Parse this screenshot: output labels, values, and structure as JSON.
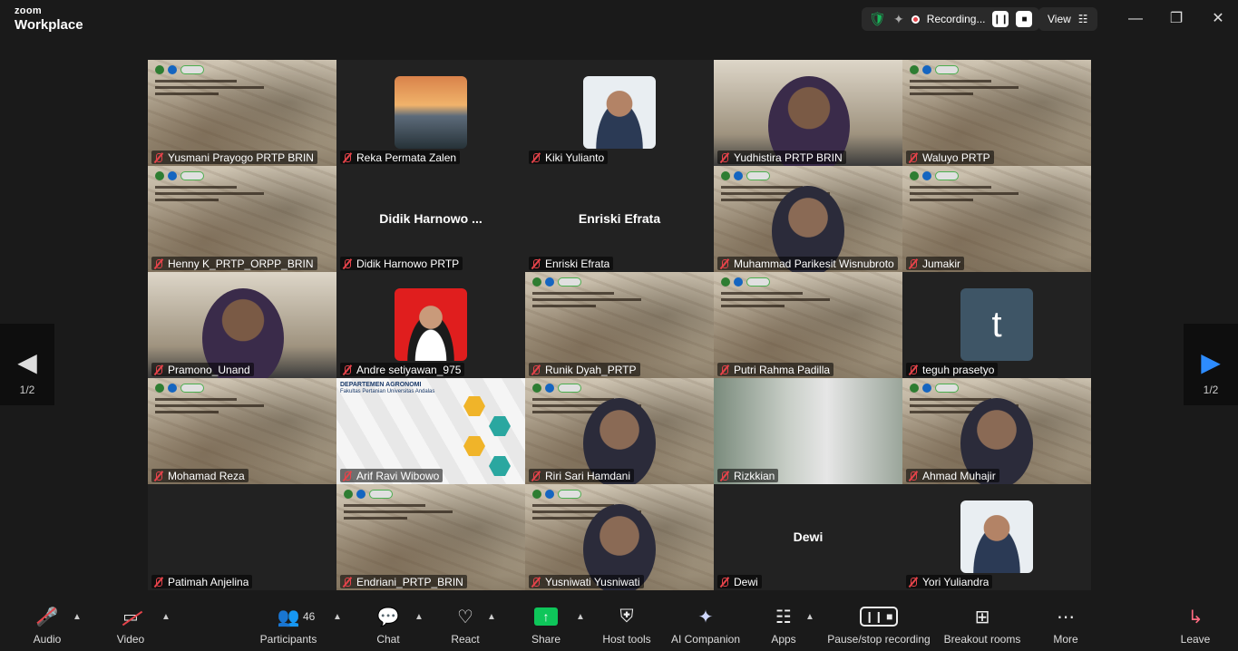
{
  "app": {
    "brand_small": "zoom",
    "brand_big": "Workplace"
  },
  "titlebar": {
    "recording_label": "Recording...",
    "view_label": "View"
  },
  "pager": {
    "left_page": "1/2",
    "right_page": "1/2"
  },
  "participants": [
    {
      "name": "Yusmani Prayogo PRTP BRIN",
      "bg": "map"
    },
    {
      "name": "Reka Permata Zalen",
      "bg": "photo-landscape"
    },
    {
      "name": "Kiki Yulianto",
      "bg": "photo-portrait"
    },
    {
      "name": "Yudhistira PRTP BRIN",
      "bg": "video"
    },
    {
      "name": "Waluyo PRTP",
      "bg": "map"
    },
    {
      "name": "Henny K_PRTP_ORPP_BRIN",
      "bg": "map"
    },
    {
      "name": "Didik Harnowo PRTP",
      "big": "Didik  Harnowo ...",
      "bg": "dark"
    },
    {
      "name": "Enriski Efrata",
      "big": "Enriski Efrata",
      "bg": "dark"
    },
    {
      "name": "Muhammad Parikesit Wisnubroto",
      "bg": "map-video",
      "active": true
    },
    {
      "name": "Jumakir",
      "bg": "map"
    },
    {
      "name": "Pramono_Unand",
      "bg": "video"
    },
    {
      "name": "Andre setiyawan_975",
      "bg": "photo-red"
    },
    {
      "name": "Runik Dyah_PRTP",
      "bg": "map"
    },
    {
      "name": "Putri Rahma Padilla",
      "bg": "map"
    },
    {
      "name": "teguh prasetyo",
      "bg": "letter",
      "letter": "t"
    },
    {
      "name": "Mohamad Reza",
      "bg": "map"
    },
    {
      "name": "Arif Ravi Wibowo",
      "bg": "slide"
    },
    {
      "name": "Riri Sari Hamdani",
      "bg": "map-video"
    },
    {
      "name": "Rizkkian",
      "bg": "blur"
    },
    {
      "name": "Ahmad Muhajir",
      "bg": "map-video"
    },
    {
      "name": "Patimah Anjelina",
      "bg": "dark"
    },
    {
      "name": "Endriani_PRTP_BRIN",
      "bg": "map"
    },
    {
      "name": "Yusniwati Yusniwati",
      "bg": "map-video"
    },
    {
      "name": "Dewi",
      "big": "Dewi",
      "bg": "dark"
    },
    {
      "name": "Yori Yuliandra",
      "bg": "photo-portrait"
    }
  ],
  "slide": {
    "dept_title": "DEPARTEMEN AGRONOMI",
    "dept_sub": "Fakultas Pertanian Universitas Andalas"
  },
  "toolbar": {
    "audio": "Audio",
    "video": "Video",
    "participants": "Participants",
    "participants_count": "46",
    "chat": "Chat",
    "react": "React",
    "share": "Share",
    "host_tools": "Host tools",
    "ai_companion": "AI Companion",
    "apps": "Apps",
    "pause_recording": "Pause/stop recording",
    "breakout_rooms": "Breakout rooms",
    "more": "More",
    "leave": "Leave"
  },
  "colors": {
    "active_speaker": "#20c997",
    "share_green": "#0ec65a",
    "muted_red": "#e5434a"
  }
}
